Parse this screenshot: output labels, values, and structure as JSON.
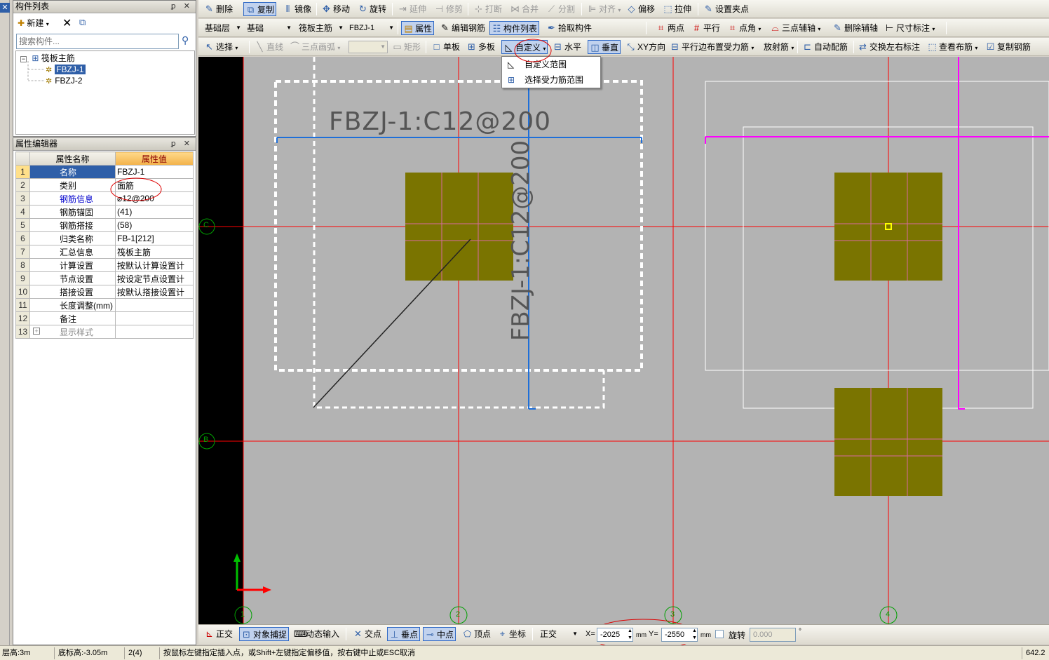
{
  "left_panel": {
    "component_list_title": "构件列表",
    "new_button": "新建",
    "search_placeholder": "搜索构件...",
    "tree_root": "筏板主筋",
    "tree_items": [
      "FBZJ-1",
      "FBZJ-2"
    ],
    "prop_editor_title": "属性编辑器",
    "prop_header_name": "属性名称",
    "prop_header_value": "属性值",
    "props": [
      {
        "n": "1",
        "name": "名称",
        "value": "FBZJ-1"
      },
      {
        "n": "2",
        "name": "类别",
        "value": "面筋"
      },
      {
        "n": "3",
        "name": "钢筋信息",
        "value": "⌀12@200"
      },
      {
        "n": "4",
        "name": "钢筋锚固",
        "value": "(41)"
      },
      {
        "n": "5",
        "name": "钢筋搭接",
        "value": "(58)"
      },
      {
        "n": "6",
        "name": "归类名称",
        "value": "FB-1[212]"
      },
      {
        "n": "7",
        "name": "汇总信息",
        "value": "筏板主筋"
      },
      {
        "n": "8",
        "name": "计算设置",
        "value": "按默认计算设置计"
      },
      {
        "n": "9",
        "name": "节点设置",
        "value": "按设定节点设置计"
      },
      {
        "n": "10",
        "name": "搭接设置",
        "value": "按默认搭接设置计"
      },
      {
        "n": "11",
        "name": "长度调整(mm)",
        "value": ""
      },
      {
        "n": "12",
        "name": "备注",
        "value": ""
      },
      {
        "n": "13",
        "name": "显示样式",
        "value": ""
      }
    ]
  },
  "toolbar1": [
    "删除",
    "复制",
    "镜像",
    "移动",
    "旋转",
    "延伸",
    "修剪",
    "打断",
    "合并",
    "分割",
    "对齐",
    "偏移",
    "拉伸",
    "设置夹点"
  ],
  "toolbar2": {
    "floor": "基础层",
    "category": "基础",
    "type": "筏板主筋",
    "component": "FBZJ-1",
    "items": [
      "属性",
      "编辑钢筋",
      "构件列表",
      "拾取构件",
      "两点",
      "平行",
      "点角",
      "三点辅轴",
      "删除辅轴",
      "尺寸标注"
    ]
  },
  "toolbar3": [
    "选择",
    "直线",
    "三点画弧",
    "矩形",
    "单板",
    "多板",
    "自定义",
    "水平",
    "垂直",
    "XY方向",
    "平行边布置受力筋",
    "放射筋",
    "自动配筋",
    "交换左右标注",
    "查看布筋",
    "复制钢筋"
  ],
  "dropdown_menu": [
    "自定义范围",
    "选择受力筋范围"
  ],
  "canvas": {
    "label_h": "FBZJ-1:C12@200",
    "label_v": "FBZJ-1:C12@200",
    "axis_rows": [
      "C",
      "B"
    ],
    "axis_cols": [
      "1",
      "2",
      "3",
      "4"
    ]
  },
  "snapbar": {
    "items": [
      "正交",
      "对象捕捉",
      "动态输入",
      "交点",
      "垂点",
      "中点",
      "顶点",
      "坐标"
    ],
    "mode": "正交",
    "x_label": "X=",
    "x_value": "-2025",
    "y_label": "Y=",
    "y_value": "-2550",
    "unit": "mm",
    "rotate_label": "旋转",
    "rotate_value": "0.000"
  },
  "status": {
    "floor_height": "层高:3m",
    "bottom_elev": "底标高:-3.05m",
    "count": "2(4)",
    "hint": "按鼠标左键指定插入点，或Shift+左键指定偏移值，按右键中止或ESC取消",
    "value": "642.2"
  },
  "colors": {
    "accent": "#2f5fa8",
    "canvas_bg": "#b3b3b3",
    "axis_red": "#ff0000",
    "olive": "#7a7400",
    "magenta": "#ff00ff",
    "rebar_blue": "#1e6fd9"
  }
}
